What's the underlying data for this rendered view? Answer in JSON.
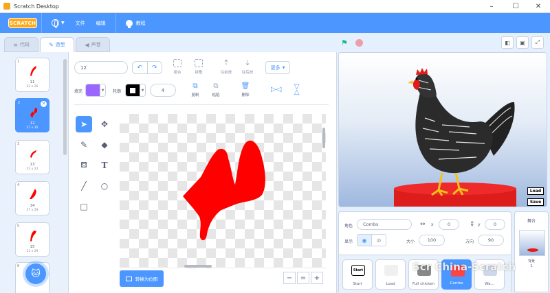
{
  "window": {
    "title": "Scratch Desktop",
    "minimize": "–",
    "maximize": "☐",
    "close": "✕"
  },
  "menubar": {
    "logo": "SCRATCH",
    "file": "文件",
    "edit": "编辑",
    "tutorials": "教程"
  },
  "tabs": {
    "code": "代码",
    "costumes": "造型",
    "sounds": "声音"
  },
  "costumes": [
    {
      "num": "1",
      "name": "11",
      "size": "22 x 25"
    },
    {
      "num": "2",
      "name": "12",
      "size": "27 x 35",
      "selected": true
    },
    {
      "num": "3",
      "name": "13",
      "size": "22 x 22"
    },
    {
      "num": "4",
      "name": "14",
      "size": "27 x 29"
    },
    {
      "num": "5",
      "name": "15",
      "size": "21 x 29"
    },
    {
      "num": "6",
      "name": "",
      "size": ""
    }
  ],
  "editor": {
    "costume_name": "12",
    "group": "组合",
    "ungroup": "拆散",
    "forward": "往前放",
    "backward": "往后放",
    "more": "更多",
    "fill_label": "填充",
    "outline_label": "轮廓",
    "outline_width": "4",
    "copy": "复制",
    "paste": "粘贴",
    "delete": "删除",
    "convert_bitmap": "转换为位图",
    "zoom_out": "−",
    "zoom_reset": "=",
    "zoom_in": "+"
  },
  "colors": {
    "fill": "#9966ff",
    "outline": "#000000",
    "shape": "#ff0000",
    "accent": "#4c97ff"
  },
  "stage": {
    "load_label": "Load",
    "save_label": "Save"
  },
  "sprite_info": {
    "sprite_label": "角色",
    "sprite_name": "Combs",
    "x_label": "x",
    "x": "0",
    "y_label": "y",
    "y": "0",
    "show_label": "显示",
    "size_label": "大小",
    "size": "100",
    "direction_label": "方向",
    "direction": "90"
  },
  "sprites": [
    {
      "name": "Start",
      "thumb": "Start"
    },
    {
      "name": "Load"
    },
    {
      "name": "Full chicken"
    },
    {
      "name": "Combs",
      "selected": true
    },
    {
      "name": "Wa..."
    }
  ],
  "stage_panel": {
    "title": "舞台",
    "backdrops_label": "背景",
    "backdrops_count": "1"
  },
  "watermark": "Scr China-Scratch"
}
